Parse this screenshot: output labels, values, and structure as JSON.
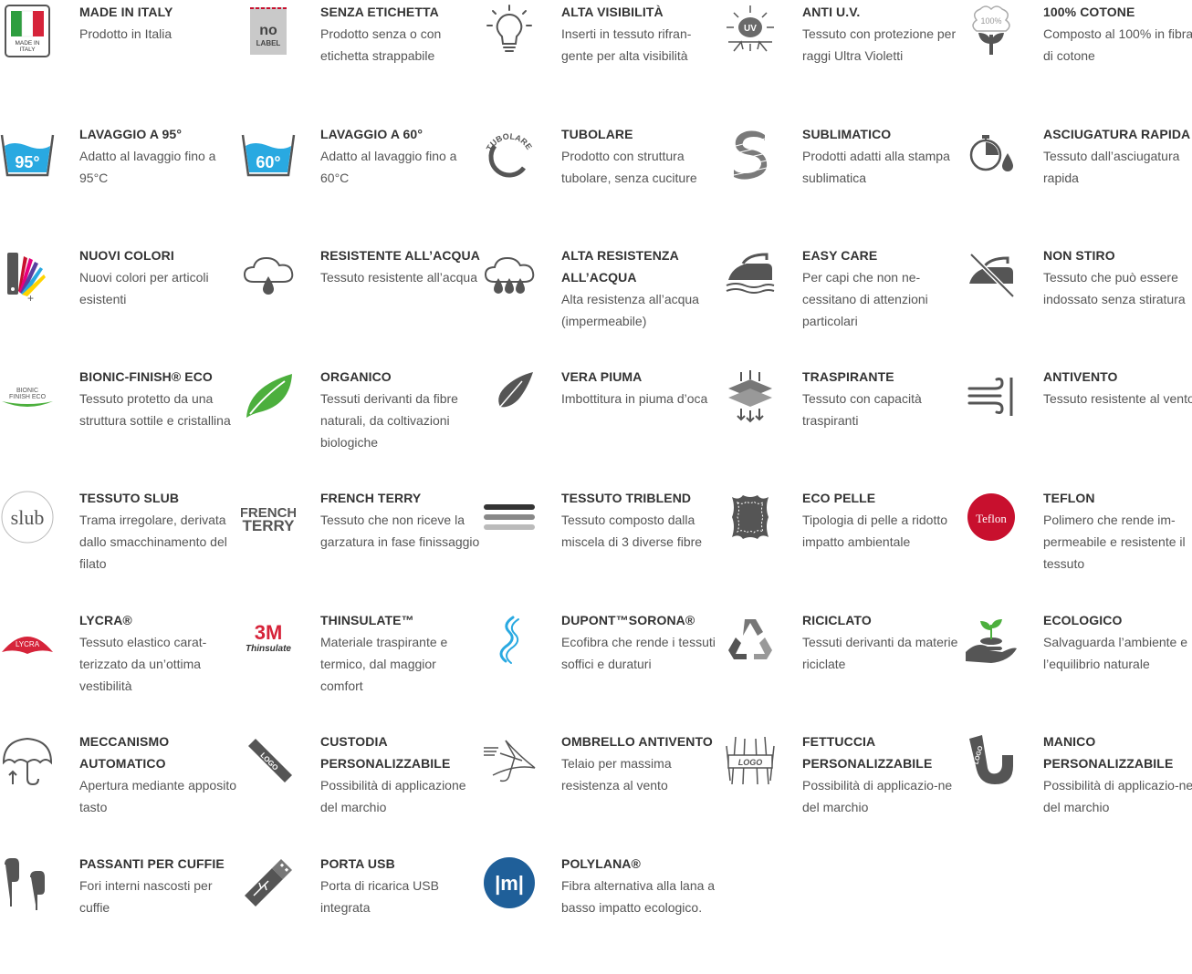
{
  "items": [
    {
      "title": "MADE IN ITALY",
      "desc": "Prodotto in Italia",
      "icon": "made-in-italy-flag-icon",
      "icon_text": "MADE IN ITALY"
    },
    {
      "title": "SENZA ETICHETTA",
      "desc": "Prodotto senza o con etichetta strappabile",
      "icon": "no-label-icon",
      "icon_text": "no LABEL"
    },
    {
      "title": "ALTA VISIBILITÀ",
      "desc": "Inserti in tessuto rifran-gente per alta visibilità",
      "icon": "lightbulb-icon"
    },
    {
      "title": "ANTI U.V.",
      "desc": "Tessuto con protezione per raggi Ultra Violetti",
      "icon": "uv-protection-icon",
      "icon_text": "UV"
    },
    {
      "title": "100% COTONE",
      "desc": "Composto al 100% in fibra di cotone",
      "icon": "cotton-plant-icon",
      "icon_text": "100%"
    },
    {
      "title": "LAVAGGIO A 95°",
      "desc": "Adatto al lavaggio fino a 95°C",
      "icon": "wash-95-icon",
      "icon_text": "95°"
    },
    {
      "title": "LAVAGGIO A 60°",
      "desc": "Adatto al lavaggio fino a 60°C",
      "icon": "wash-60-icon",
      "icon_text": "60°"
    },
    {
      "title": "TUBOLARE",
      "desc": "Prodotto con struttura tubolare, senza cuciture",
      "icon": "tubular-icon",
      "icon_text": "TUBOLARE"
    },
    {
      "title": "SUBLIMATICO",
      "desc": "Prodotti adatti alla stampa sublimatica",
      "icon": "sublimation-s-icon"
    },
    {
      "title": "ASCIUGATURA RAPIDA",
      "desc": "Tessuto dall’asciugatura rapida",
      "icon": "stopwatch-drop-icon"
    },
    {
      "title": "NUOVI COLORI",
      "desc": "Nuovi colori per articoli esistenti",
      "icon": "color-swatches-icon"
    },
    {
      "title": "RESISTENTE ALL’ACQUA",
      "desc": "Tessuto resistente all’acqua",
      "icon": "cloud-drop-icon"
    },
    {
      "title": "ALTA RESISTENZA ALL’ACQUA",
      "desc": "Alta resistenza all’acqua (impermeabile)",
      "icon": "cloud-drops-icon"
    },
    {
      "title": "EASY CARE",
      "desc": "Per capi che non ne-cessitano di attenzioni particolari",
      "icon": "iron-icon"
    },
    {
      "title": "NON STIRO",
      "desc": "Tessuto che può essere indossato senza stiratura",
      "icon": "no-iron-icon"
    },
    {
      "title": "BIONIC-FINISH® ECO",
      "desc": "Tessuto protetto da una struttura sottile e cristallina",
      "icon": "bionic-finish-logo-icon",
      "icon_text": "BIONIC FINISH ECO"
    },
    {
      "title": "ORGANICO",
      "desc": "Tessuti derivanti da fibre naturali, da coltivazioni biologiche",
      "icon": "leaf-icon"
    },
    {
      "title": "VERA PIUMA",
      "desc": "Imbottitura in piuma d’oca",
      "icon": "feather-icon"
    },
    {
      "title": "TRASPIRANTE",
      "desc": "Tessuto con capacità traspiranti",
      "icon": "breathable-layers-icon"
    },
    {
      "title": "ANTIVENTO",
      "desc": "Tessuto resistente al vento",
      "icon": "wind-icon"
    },
    {
      "title": "TESSUTO SLUB",
      "desc": "Trama irregolare, derivata dallo smacchinamento del filato",
      "icon": "slub-logo-icon",
      "icon_text": "slub"
    },
    {
      "title": "FRENCH TERRY",
      "desc": "Tessuto che non riceve la garzatura in fase finissaggio",
      "icon": "french-terry-logo-icon",
      "icon_text": "FRENCH TERRY"
    },
    {
      "title": "TESSUTO TRIBLEND",
      "desc": "Tessuto composto dalla miscela di 3 diverse fibre",
      "icon": "triblend-bars-icon"
    },
    {
      "title": "ECO PELLE",
      "desc": "Tipologia di pelle a ridotto impatto ambientale",
      "icon": "leather-hide-icon"
    },
    {
      "title": "TEFLON",
      "desc": "Polimero che rende im-permeabile e resistente il tessuto",
      "icon": "teflon-logo-icon",
      "icon_text": "Teflon"
    },
    {
      "title": "LYCRA®",
      "desc": "Tessuto elastico carat-terizzato da un’ottima vestibilità",
      "icon": "lycra-logo-icon",
      "icon_text": "LYCRA"
    },
    {
      "title": "THINSULATE™",
      "desc": "Materiale traspirante e termico, dal maggior comfort",
      "icon": "3m-thinsulate-logo-icon",
      "icon_text": "3M Thinsulate"
    },
    {
      "title": "DUPONT™SORONA®",
      "desc": "Ecofibra che rende i tessuti soffici e duraturi",
      "icon": "sorona-logo-icon"
    },
    {
      "title": "RICICLATO",
      "desc": "Tessuti derivanti da materie riciclate",
      "icon": "recycle-icon"
    },
    {
      "title": "ECOLOGICO",
      "desc": "Salvaguarda l’ambiente e l’equilibrio naturale",
      "icon": "hand-sprout-icon"
    },
    {
      "title": "MECCANISMO AUTOMATICO",
      "desc": "Apertura mediante apposito tasto",
      "icon": "umbrella-icon"
    },
    {
      "title": "CUSTODIA PERSONALIZZABILE",
      "desc": "Possibilità di applicazione del marchio",
      "icon": "umbrella-sleeve-logo-icon",
      "icon_text": "LOGO"
    },
    {
      "title": "OMBRELLO ANTIVENTO",
      "desc": "Telaio per massima resistenza al vento",
      "icon": "windproof-umbrella-icon"
    },
    {
      "title": "FETTUCCIA PERSONALIZZABILE",
      "desc": "Possibilità di applicazio-ne del marchio",
      "icon": "strap-logo-icon",
      "icon_text": "LOGO"
    },
    {
      "title": "MANICO PERSONALIZZABILE",
      "desc": "Possibilità di applicazio-ne del marchio",
      "icon": "handle-logo-icon",
      "icon_text": "LOGO"
    },
    {
      "title": "PASSANTI PER CUFFIE",
      "desc": "Fori interni nascosti per cuffie",
      "icon": "earphones-icon"
    },
    {
      "title": "PORTA USB",
      "desc": "Porta di ricarica USB integrata",
      "icon": "usb-stick-icon"
    },
    {
      "title": "POLYLANA®",
      "desc": "Fibra alternativa alla lana a basso impatto ecologico.",
      "icon": "polylana-logo-icon",
      "icon_text": "|m|"
    }
  ],
  "colors": {
    "icon_gray": "#5a5a5a",
    "text_dark": "#333333",
    "text_body": "#555555",
    "accent_blue": "#29a9e1",
    "accent_green": "#4caf3d",
    "accent_red": "#c8102e"
  }
}
